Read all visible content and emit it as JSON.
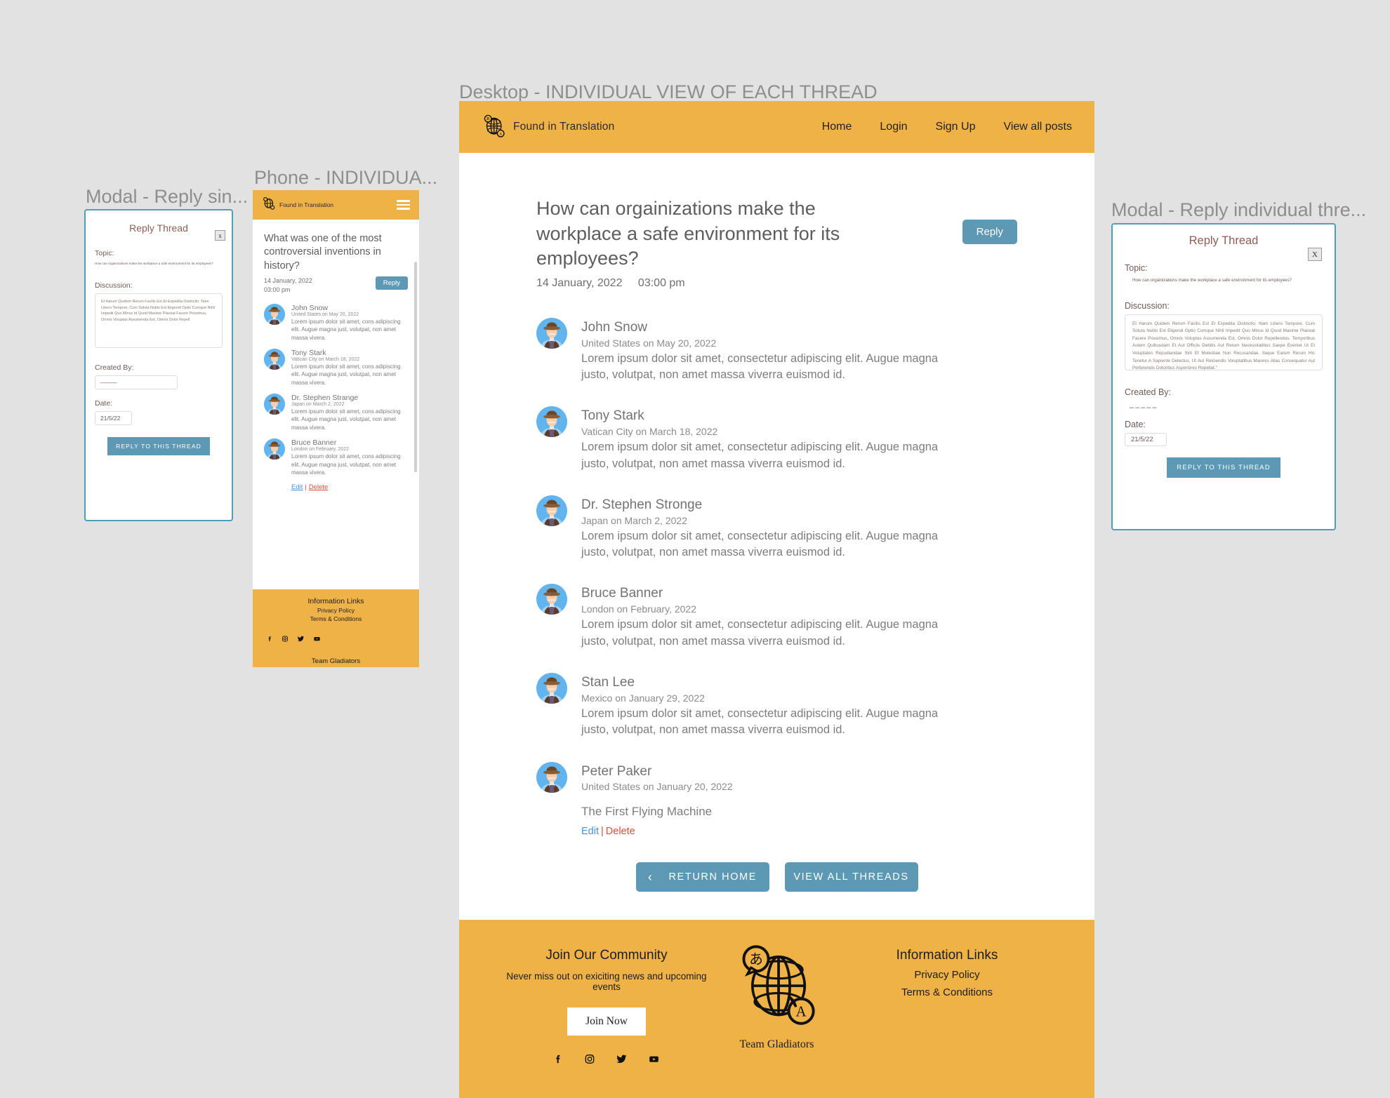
{
  "mock_labels": {
    "desktop": "Desktop -  INDIVIDUAL VIEW OF EACH THREAD",
    "phone": "Phone - INDIVIDUA...",
    "modal_left": "Modal - Reply sin...",
    "modal_right": "Modal - Reply individual thre..."
  },
  "colors": {
    "brand_yellow": "#efb247",
    "accent_blue": "#5d99b4",
    "modal_border": "#4f9fb4",
    "edit_link": "#4a90d9",
    "delete_link": "#d8503c",
    "canvas": "#e2e2e2"
  },
  "desktop": {
    "header": {
      "logo_icon": "globe-translate-icon",
      "brand": "Found in Translation",
      "nav": [
        {
          "label": "Home"
        },
        {
          "label": "Login"
        },
        {
          "label": "Sign Up"
        },
        {
          "label": "View all posts"
        }
      ]
    },
    "thread": {
      "title": "How can orgainizations make the workplace a safe environment for its employees?",
      "date": "14 January, 2022",
      "time": "03:00 pm",
      "reply_label": "Reply"
    },
    "comments": [
      {
        "name": "John Snow",
        "meta": "United States on May 20, 2022",
        "text": "Lorem ipsum dolor sit amet, consectetur adipiscing elit. Augue magna justo, volutpat, non amet massa viverra euismod id."
      },
      {
        "name": "Tony Stark",
        "meta": "Vatican City on March 18, 2022",
        "text": "Lorem ipsum dolor sit amet, consectetur adipiscing elit. Augue magna justo, volutpat, non amet massa viverra euismod id."
      },
      {
        "name": "Dr. Stephen Stronge",
        "meta": "Japan on March 2, 2022",
        "text": "Lorem ipsum dolor sit amet, consectetur adipiscing elit. Augue magna justo, volutpat, non amet massa viverra euismod id."
      },
      {
        "name": "Bruce  Banner",
        "meta": "London on February, 2022",
        "text": "Lorem ipsum dolor sit amet, consectetur adipiscing elit. Augue magna justo, volutpat, non amet massa viverra euismod id."
      },
      {
        "name": "Stan Lee",
        "meta": "Mexico on January 29, 2022",
        "text": "Lorem ipsum dolor sit amet, consectetur adipiscing elit. Augue magna justo, volutpat, non amet massa viverra euismod id."
      }
    ],
    "last_comment": {
      "name": "Peter Paker",
      "meta": "United States on January 20, 2022",
      "post_title": "The First Flying Machine",
      "edit_label": "Edit",
      "separator": "|",
      "delete_label": "Delete"
    },
    "actions": {
      "return_home": "RETURN HOME",
      "view_all_threads": "VIEW ALL THREADS",
      "back_chevron": "‹"
    },
    "footer": {
      "join_heading": "Join Our Community",
      "join_sub": "Never miss out on exiciting news and upcoming events",
      "join_button": "Join Now",
      "socials": [
        "facebook-icon",
        "instagram-icon",
        "twitter-icon",
        "youtube-icon"
      ],
      "logo_icon": "globe-translate-icon",
      "logo_ja_char": "あ",
      "logo_en_char": "A",
      "team": "Team Gladiators",
      "links_heading": "Information Links",
      "links": [
        "Privacy Policy",
        "Terms & Conditions"
      ]
    }
  },
  "phone": {
    "header": {
      "brand": "Found in Translation",
      "menu_icon": "hamburger-menu-icon"
    },
    "thread": {
      "title": "What was one of the most controversial inventions in history?",
      "date": "14 January, 2022",
      "time": "03:00 pm",
      "reply_label": "Reply"
    },
    "comments": [
      {
        "name": "John Snow",
        "meta": "United States on May 20, 2022",
        "text": "Lorem ipsum dolor sit amet, cons adipiscing elit. Augue magna just, volutpat, non amet massa vivera."
      },
      {
        "name": "Tony Stark",
        "meta": "Vatican City on March 18, 2022",
        "text": "Lorem ipsum dolor sit amet, cons adipiscing elit. Augue magna just, volutpat, non amet massa vivera."
      },
      {
        "name": "Dr. Stephen Strange",
        "meta": "Japan on March 2, 2022",
        "text": "Lorem ipsum dolor sit amet, cons adipiscing elit. Augue magna just, volutpat, non amet massa vivera."
      },
      {
        "name": "Bruce  Banner",
        "meta": "London on February, 2022",
        "text": "Lorem ipsum dolor sit amet, cons adipiscing elit. Augue magna just, volutpat, non amet massa vivera."
      }
    ],
    "edit_label": "Edit",
    "separator": "|",
    "delete_label": "Delete",
    "footer": {
      "links_heading": "Information Links",
      "links": [
        "Privacy Policy",
        "Terms & Conditions"
      ],
      "socials": [
        "facebook-icon",
        "instagram-icon",
        "twitter-icon",
        "youtube-icon"
      ],
      "team": "Team Gladiators"
    }
  },
  "modal_left": {
    "title": "Reply Thread",
    "close_label": "x",
    "topic_label": "Topic:",
    "topic_value": "How can orgainizations make the workplace a safe environment for its employees?",
    "discussion_label": "Discussion:",
    "discussion_value": "Et Harum Quidem Rerum Facilis Est Et Expedita Distinctio. Nam Libero Tempore, Cum Soluta Nobis Est Eligendi Optio Cumque Nihil Impedit Quo Minus Id Quod Maxime Placeat Facere Possimus, Omnis Voluptas Assumenda Est, Omnis Dolor Repell",
    "created_by_label": "Created By:",
    "created_by_value": "–––––",
    "date_label": "Date:",
    "date_value": "21/5/22",
    "submit_label": "REPLY TO THIS THREAD"
  },
  "modal_right": {
    "title": "Reply Thread",
    "close_label": "X",
    "topic_label": "Topic:",
    "topic_value": "How can orgainizations make the workplace a safe environment for its employees?",
    "discussion_label": "Discussion:",
    "discussion_value": "Et Harum Quidem Rerum Facilis Est Et Expedita Distinctio. Nam Libero Tempore, Cum Soluta Nobis Est Eligendi Optio Cumque Nihil Impedit Quo Minus Id Quod Maxime Placeat Facere Possimus, Omnis Voluptas Assumenda Est, Omnis Dolor Repellendus. Temporibus Autem Quibusdam Et Aut Officiis Debitis Aut Rerum Necessitatibus Saepe Eveniet Ut Et Voluptates Repudiandae Sint Et Molestiae Non Recusandae. Itaque Earum Rerum Hic Tenetur A Sapiente Delectus, Ut Aut Reiciendis Voluptatibus Maiores Alias Consequatur Aut Perferendis Doloribus Asperiores Repellat.\"",
    "created_by_label": "Created By:",
    "created_by_value": "–––––",
    "date_label": "Date:",
    "date_value": "21/5/22",
    "submit_label": "REPLY TO THIS THREAD"
  }
}
